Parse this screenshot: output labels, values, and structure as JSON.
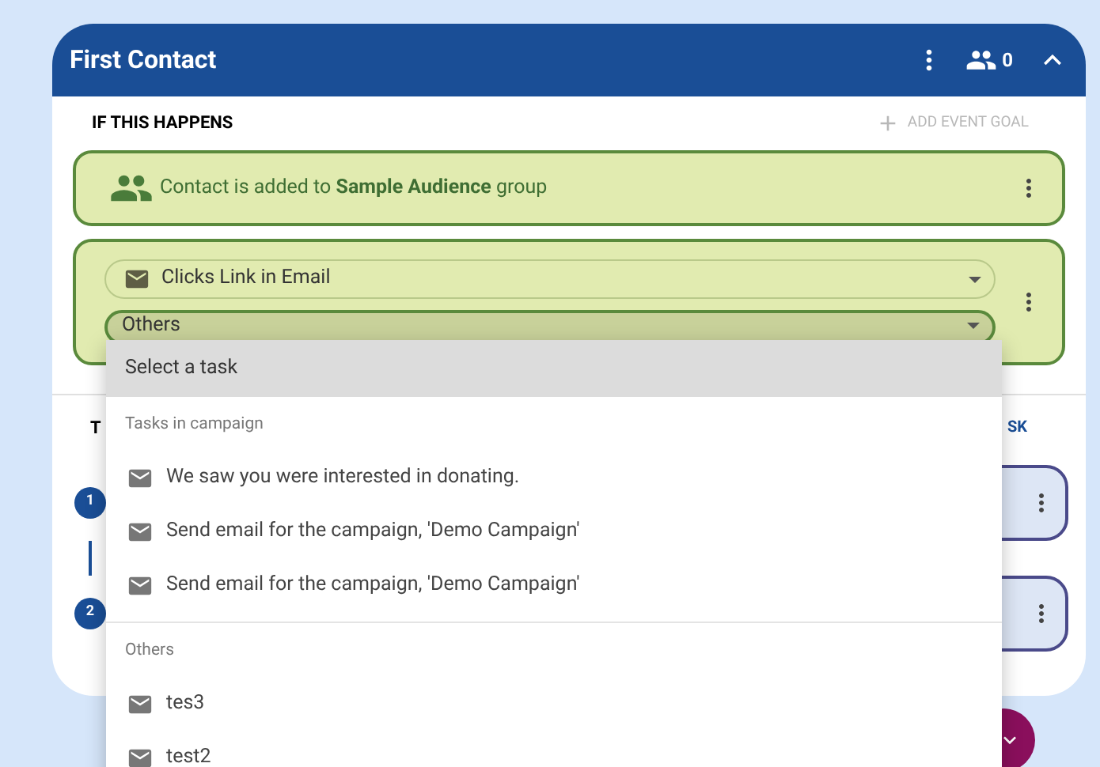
{
  "card": {
    "title": "First Contact",
    "member_count": "0",
    "expanded": true
  },
  "trigger_section": {
    "heading": "IF THIS HAPPENS",
    "add_button": "ADD EVENT GOAL"
  },
  "events": [
    {
      "kind": "audience",
      "text": "Contact is added to **Sample Audience** group"
    },
    {
      "kind": "email",
      "action": "Clicks Link in Email",
      "task": "Others"
    }
  ],
  "then_section": {
    "heading": "T",
    "add_button": "SK"
  },
  "steps": [
    {
      "number": "1"
    },
    {
      "number": "2"
    }
  ],
  "task_menu": {
    "first_option": {
      "label": "Select a task",
      "highlighted": true
    },
    "groups": [
      {
        "heading": "Tasks in campaign",
        "options": [
          {
            "label": "We saw you were interested in donating."
          },
          {
            "label": "Send email for the campaign, 'Demo Campaign'"
          },
          {
            "label": "Send email for the campaign, 'Demo Campaign'"
          }
        ]
      },
      {
        "heading": "Others",
        "options": [
          {
            "label": "tes3"
          },
          {
            "label": "test2"
          }
        ]
      }
    ]
  }
}
